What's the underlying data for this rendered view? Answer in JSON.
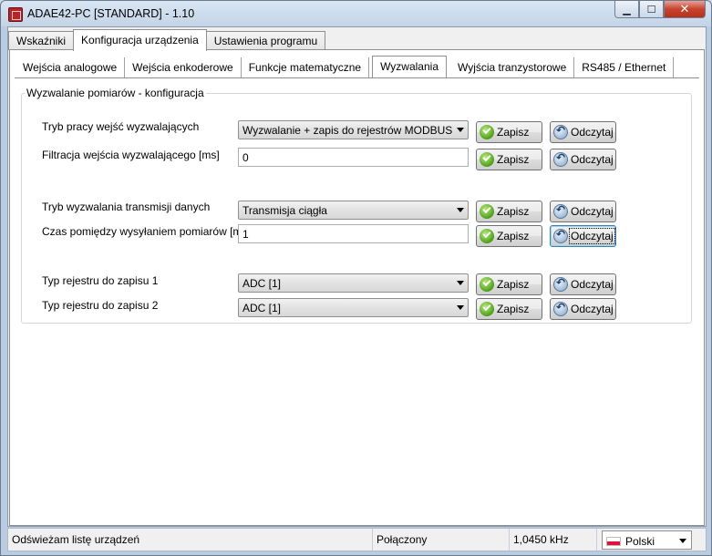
{
  "window": {
    "title": "ADAE42-PC [STANDARD] - 1.10",
    "minimize_glyph": "▁",
    "maximize_glyph": "☐",
    "close_glyph": "✕"
  },
  "main_tabs": [
    {
      "label": "Wskaźniki"
    },
    {
      "label": "Konfiguracja urządzenia"
    },
    {
      "label": "Ustawienia programu"
    }
  ],
  "sub_tabs": [
    {
      "label": "Wejścia analogowe"
    },
    {
      "label": "Wejścia enkoderowe"
    },
    {
      "label": "Funkcje matematyczne"
    },
    {
      "label": "Wyzwalania"
    },
    {
      "label": "Wyjścia tranzystorowe"
    },
    {
      "label": "RS485 / Ethernet"
    }
  ],
  "group": {
    "title": "Wyzwalanie pomiarów - konfiguracja",
    "rows": [
      {
        "label": "Tryb pracy wejść wyzwalających",
        "type": "combo",
        "value": "Wyzwalanie + zapis do rejestrów MODBUS"
      },
      {
        "label": "Filtracja wejścia wyzwalającego [ms]",
        "type": "text",
        "value": "0"
      },
      {
        "label": "Tryb wyzwalania transmisji danych",
        "type": "combo",
        "value": "Transmisja ciągła"
      },
      {
        "label": "Czas pomiędzy wysyłaniem pomiarów [ms]",
        "type": "text",
        "value": "1"
      },
      {
        "label": "Typ rejestru do zapisu 1",
        "type": "combo",
        "value": "ADC [1]"
      },
      {
        "label": "Typ rejestru do zapisu 2",
        "type": "combo",
        "value": "ADC [1]"
      }
    ],
    "save_label": "Zapisz",
    "read_label": "Odczytaj"
  },
  "status": {
    "message": "Odświeżam listę urządzeń",
    "connection": "Połączony",
    "frequency": "1,0450 kHz",
    "language": "Polski"
  },
  "icons": {
    "save": "check-icon",
    "read": "refresh-icon"
  }
}
